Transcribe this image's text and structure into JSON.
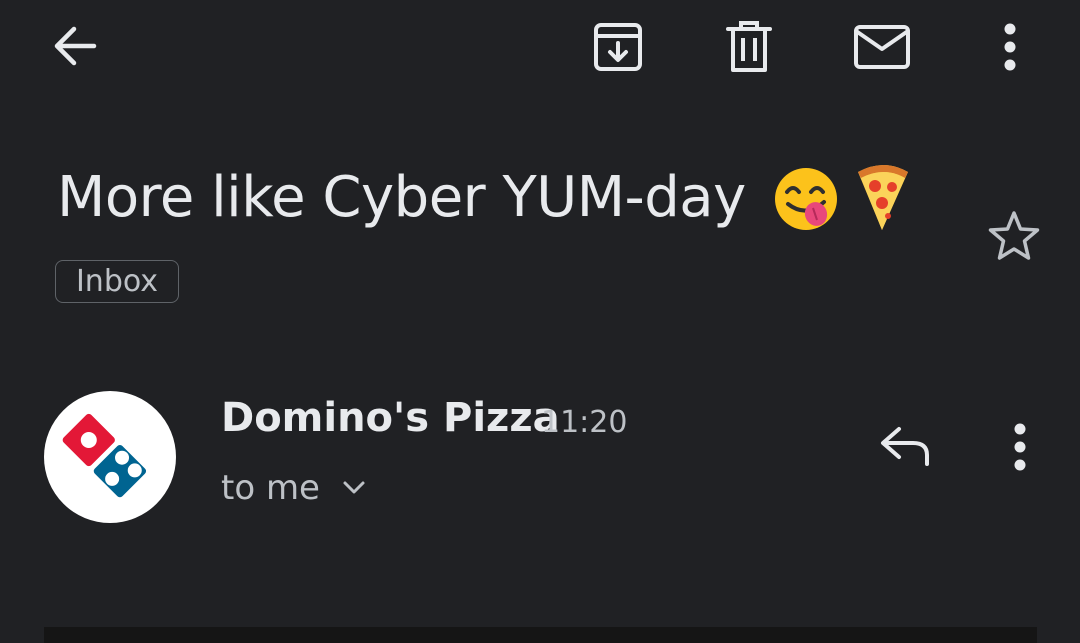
{
  "toolbar": {
    "back_icon": "arrow-back-icon",
    "archive_icon": "archive-icon",
    "delete_icon": "trash-icon",
    "mark_unread_icon": "mail-icon",
    "overflow_icon": "more-vert-icon"
  },
  "email": {
    "subject": "More like Cyber YUM-day",
    "subject_emojis": [
      "face-savoring-food-emoji",
      "pizza-emoji"
    ],
    "label": "Inbox",
    "sender": "Domino's Pizza",
    "time": "11:20",
    "recipient": "to me",
    "avatar": "dominos-logo"
  },
  "colors": {
    "background": "#202124",
    "text_primary": "#e8eaed",
    "text_secondary": "#bdc1c6",
    "dominos_red": "#e31837",
    "dominos_blue": "#006491"
  }
}
